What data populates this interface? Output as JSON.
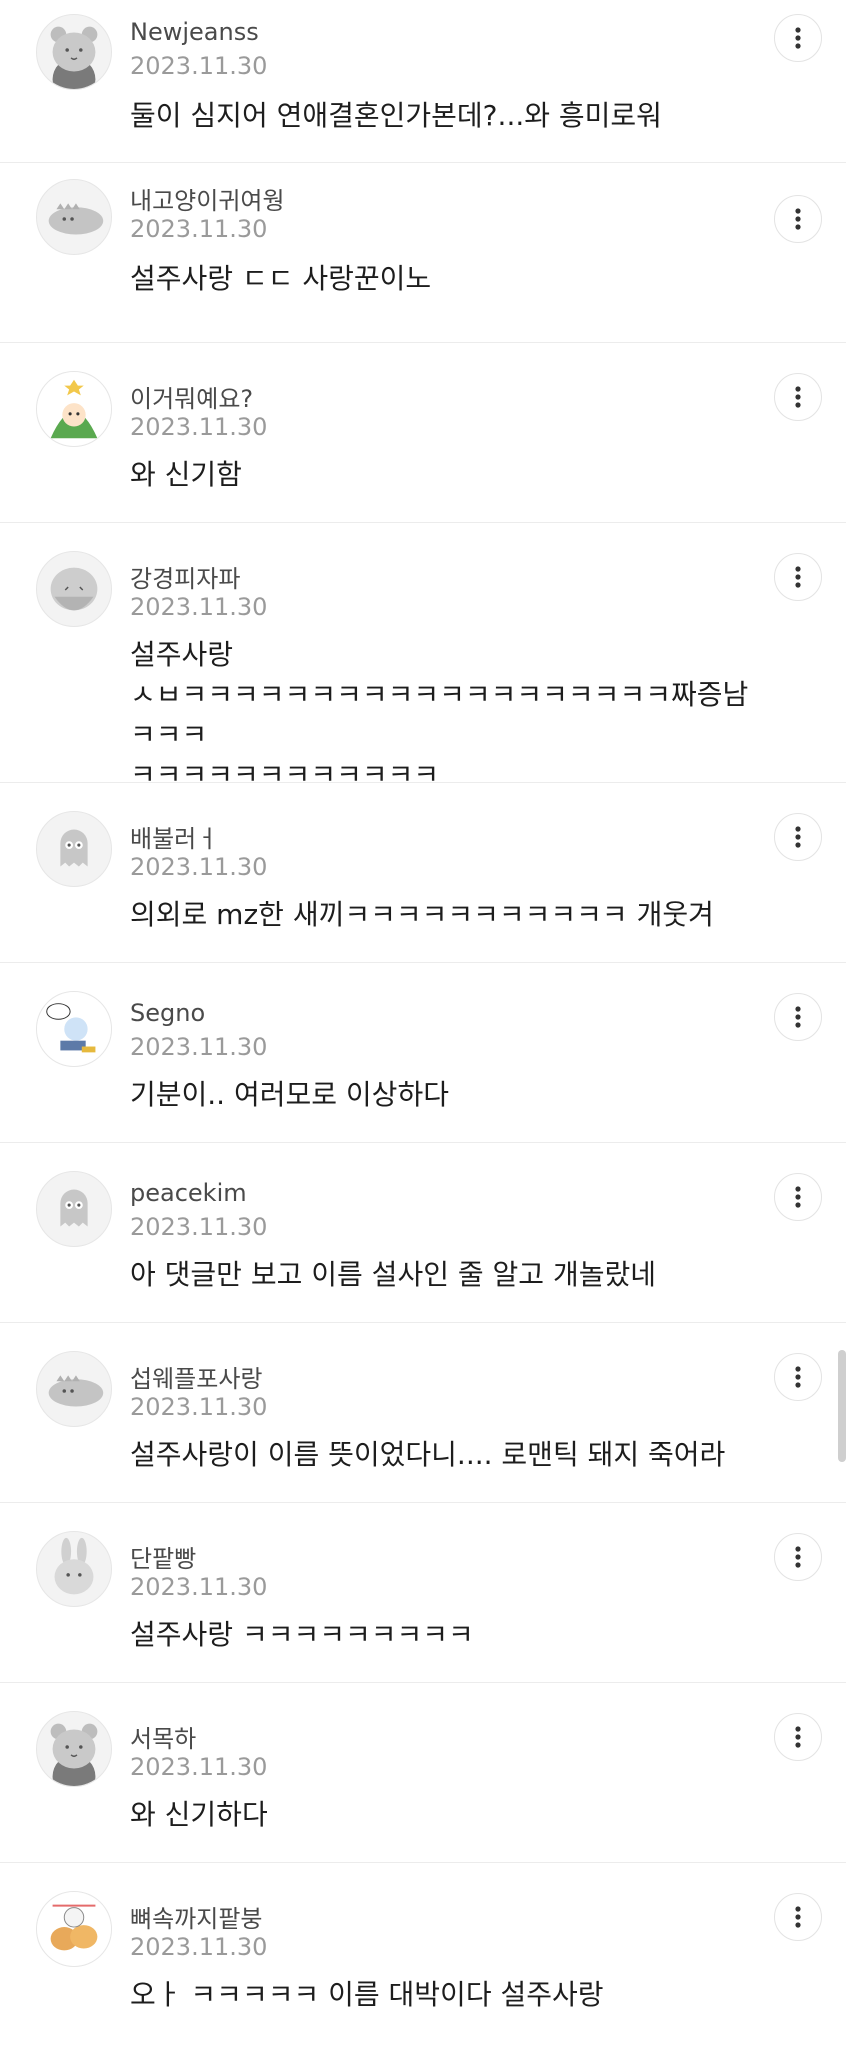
{
  "comments": [
    {
      "username": "Newjeanss",
      "date": "2023.11.30",
      "text": "둘이 심지어 연애결혼인가본데?...와 흥미로워",
      "avatar": "gray-bear-icon"
    },
    {
      "username": "내고양이귀여웡",
      "date": "2023.11.30",
      "text": "설주사랑 ㄷㄷ 사랑꾼이노",
      "avatar": "gray-dinosaur-icon"
    },
    {
      "username": "이거뭐예요?",
      "date": "2023.11.30",
      "text": "와 신기함",
      "avatar": "christmas-tree-character-icon"
    },
    {
      "username": "강경피자파",
      "date": "2023.11.30",
      "text": "설주사랑\nㅅㅂㅋㅋㅋㅋㅋㅋㅋㅋㅋㅋㅋㅋㅋㅋㅋㅋㅋㅋㅋ짜증남ㅋㅋㅋ\nㅋㅋㅋㅋㅋㅋㅋㅋㅋㅋㅋㅋ",
      "avatar": "old-man-icon"
    },
    {
      "username": "배불러ㅓ",
      "date": "2023.11.30",
      "text": "의외로 mz한 새끼ㅋㅋㅋㅋㅋㅋㅋㅋㅋㅋㅋ 개웃겨",
      "avatar": "gray-ghost-icon"
    },
    {
      "username": "Segno",
      "date": "2023.11.30",
      "text": "기분이.. 여러모로 이상하다",
      "avatar": "character-sticker-icon"
    },
    {
      "username": "peacekim",
      "date": "2023.11.30",
      "text": "아 댓글만 보고 이름 설사인 줄 알고 개놀랐네",
      "avatar": "gray-ghost-icon"
    },
    {
      "username": "섭웨플포사랑",
      "date": "2023.11.30",
      "text": "설주사랑이 이름 뜻이었다니.... 로맨틱 돼지 죽어라",
      "avatar": "gray-dinosaur-icon"
    },
    {
      "username": "단팥빵",
      "date": "2023.11.30",
      "text": "설주사랑 ㅋㅋㅋㅋㅋㅋㅋㅋㅋ",
      "avatar": "gray-rabbit-icon"
    },
    {
      "username": "서목하",
      "date": "2023.11.30",
      "text": "와 신기하다",
      "avatar": "gray-bear-icon"
    },
    {
      "username": "뼈속까지팥붕",
      "date": "2023.11.30",
      "text": "오ㅏ ㅋㅋㅋㅋㅋ 이름 대박이다 설주사랑",
      "avatar": "bungeoppang-icon"
    }
  ]
}
